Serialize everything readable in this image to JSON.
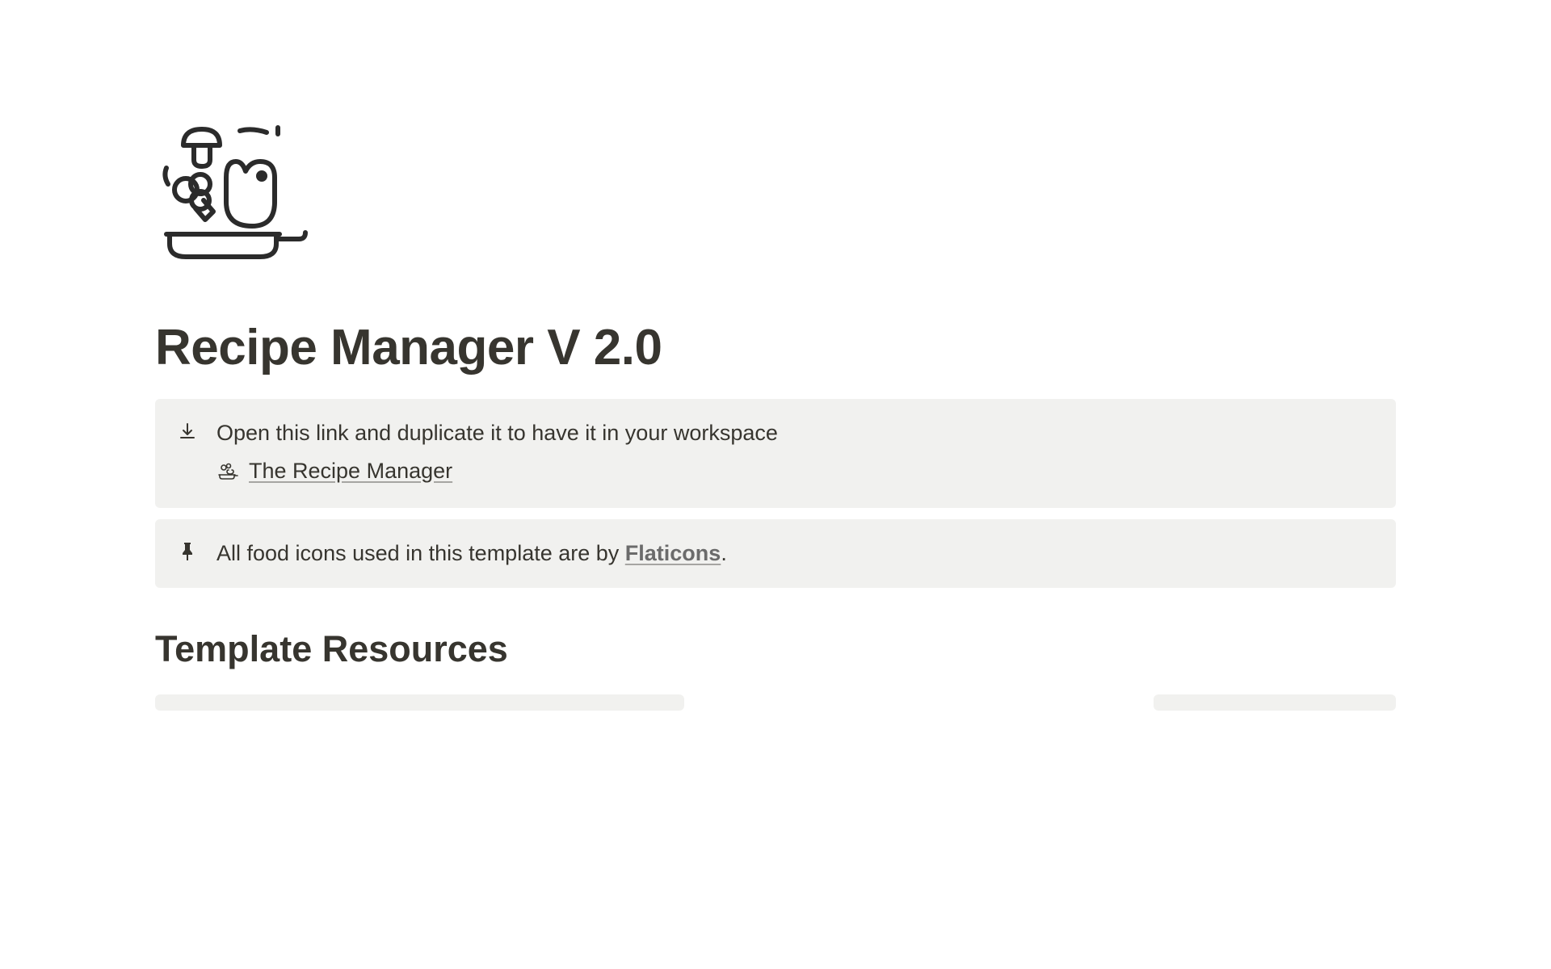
{
  "page": {
    "title": "Recipe Manager V 2.0"
  },
  "callouts": {
    "duplicate": {
      "text": "Open this link and duplicate it to have it in your workspace",
      "link_label": "The Recipe Manager"
    },
    "attribution": {
      "text_prefix": "All food icons used in this template are by ",
      "link_label": "Flaticons",
      "text_suffix": "."
    }
  },
  "sections": {
    "resources_heading": "Template Resources"
  }
}
